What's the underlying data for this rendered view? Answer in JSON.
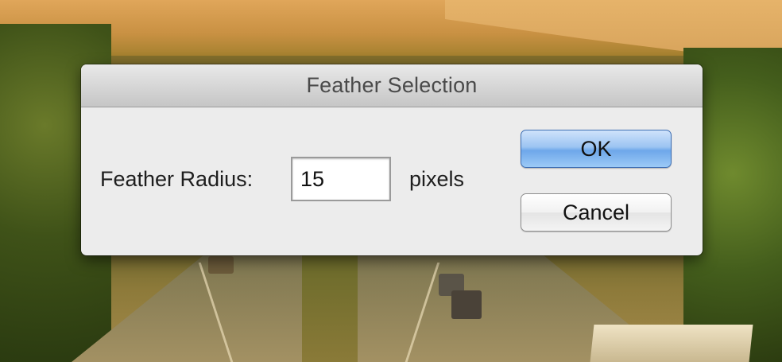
{
  "dialog": {
    "title": "Feather Selection",
    "radius_label": "Feather Radius:",
    "radius_value": "15",
    "unit_label": "pixels",
    "ok_label": "OK",
    "cancel_label": "Cancel"
  },
  "colors": {
    "ok_button_accent": "#6ea7ea",
    "dialog_background": "#ececec"
  }
}
